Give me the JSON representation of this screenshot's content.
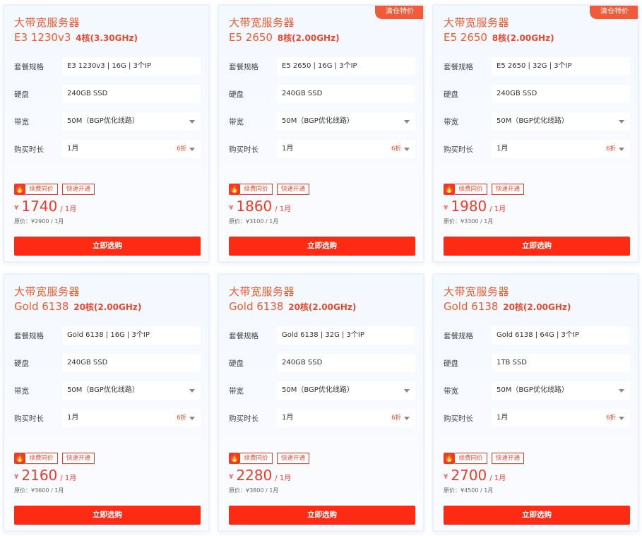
{
  "common": {
    "title": "大带宽服务器",
    "label_spec": "套餐规格",
    "label_disk": "硬盘",
    "label_bandwidth": "带宽",
    "label_duration": "购买时长",
    "bandwidth_value": "50M（BGP优化线路）",
    "duration_value": "1月",
    "discount": "6折",
    "badge_renew": "续费同价",
    "badge_fast": "快速开通",
    "fire_icon": "🔥",
    "currency": "¥",
    "per_month": "/ 1月",
    "buy_label": "立即选购",
    "ribbon": "清仓特价"
  },
  "cards": [
    {
      "model": "E3 1230v3",
      "cores": "4核(3.30GHz)",
      "spec": "E3 1230v3 | 16G | 3个IP",
      "disk": "240GB SSD",
      "price": "1740",
      "original": "原价：¥2900 / 1月",
      "ribbon": ""
    },
    {
      "model": "E5 2650",
      "cores": "8核(2.00GHz)",
      "spec": "E5 2650 | 16G | 3个IP",
      "disk": "240GB SSD",
      "price": "1860",
      "original": "原价：¥3100 / 1月",
      "ribbon": "清仓特价"
    },
    {
      "model": "E5 2650",
      "cores": "8核(2.00GHz)",
      "spec": "E5 2650 | 32G | 3个IP",
      "disk": "240GB SSD",
      "price": "1980",
      "original": "原价：¥3300 / 1月",
      "ribbon": "清仓特价"
    },
    {
      "model": "Gold 6138",
      "cores": "20核(2.00GHz)",
      "spec": "Gold 6138 | 16G | 3个IP",
      "disk": "240GB SSD",
      "price": "2160",
      "original": "原价：¥3600 / 1月",
      "ribbon": ""
    },
    {
      "model": "Gold 6138",
      "cores": "20核(2.00GHz)",
      "spec": "Gold 6138 | 32G | 3个IP",
      "disk": "240GB SSD",
      "price": "2280",
      "original": "原价：¥3800 / 1月",
      "ribbon": ""
    },
    {
      "model": "Gold 6138",
      "cores": "20核(2.00GHz)",
      "spec": "Gold 6138 | 64G | 3个IP",
      "disk": "1TB SSD",
      "price": "2700",
      "original": "原价：¥4500 / 1月",
      "ribbon": ""
    }
  ],
  "colors": {
    "accent": "#f05a28",
    "button": "#fd2a14"
  }
}
